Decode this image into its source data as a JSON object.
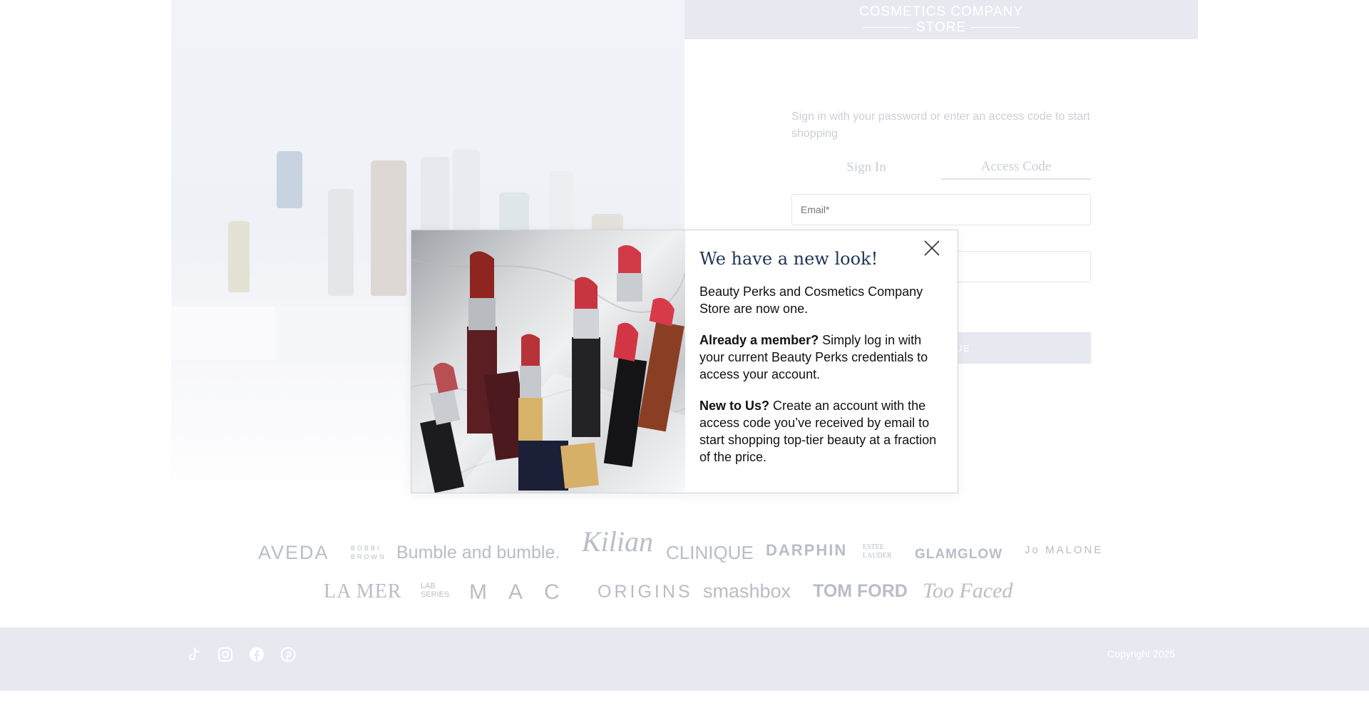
{
  "header": {
    "logo_line1": "COSMETICS COMPANY",
    "logo_line2": "STORE"
  },
  "signin": {
    "intro": "Sign in with your password or enter an access code to start shopping",
    "tabs": [
      {
        "label": "Sign In",
        "active": false
      },
      {
        "label": "Access Code",
        "active": true
      }
    ],
    "email_placeholder": "Email*",
    "code_placeholder": "",
    "continue_label": "CONTINUE"
  },
  "brands": [
    "AVEDA",
    "BOBBI BROWN",
    "Bumble and bumble.",
    "Kilian",
    "CLINIQUE",
    "DARPHIN",
    "ESTEE LAUDER",
    "GLAMGLOW",
    "Jo MALONE",
    "LA MER",
    "LAB SERIES",
    "MAC",
    "ORIGINS",
    "smashbox",
    "TOM FORD",
    "Too Faced"
  ],
  "footer": {
    "social_icons": [
      "tiktok-icon",
      "instagram-icon",
      "facebook-icon",
      "pinterest-icon"
    ],
    "copyright": "Copyright 2025"
  },
  "modal": {
    "title": "We have a new look!",
    "p1": "Beauty Perks and Cosmetics Company Store are now one.",
    "p2_bold": "Already a member?",
    "p2_text": " Simply log in with your current Beauty Perks credentials to access your account.",
    "p3_bold": "New to Us?",
    "p3_text": " Create an account with the access code you’ve received by email to start shopping top-tier beauty at a fraction of the price."
  },
  "colors": {
    "header_bg": "#e6e9f0",
    "title": "#1f3557",
    "muted_text": "#c9ced8"
  }
}
